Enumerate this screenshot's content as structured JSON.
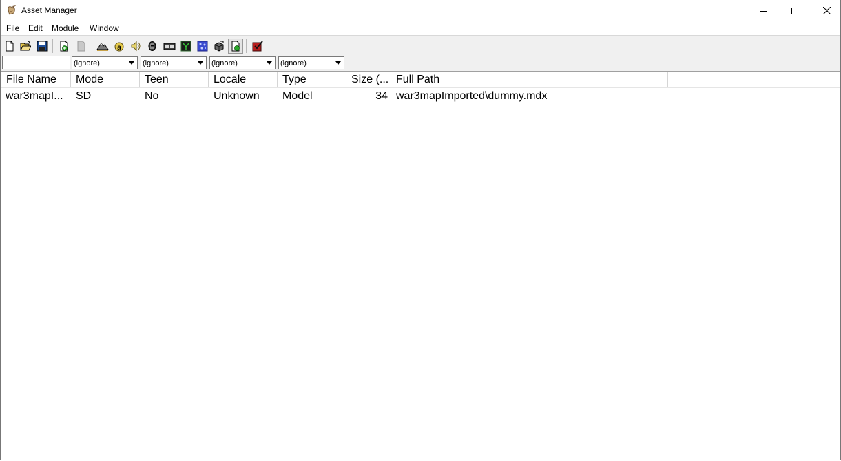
{
  "window": {
    "title": "Asset Manager",
    "icon": "scroll-quill-icon",
    "controls": [
      "minimize-icon",
      "maximize-icon",
      "close-icon"
    ]
  },
  "menu": {
    "items": [
      {
        "label": "File"
      },
      {
        "label": "Edit"
      },
      {
        "label": "Module"
      },
      {
        "label": "Window"
      }
    ]
  },
  "toolbar": {
    "buttons": [
      {
        "icon": "new-document-icon"
      },
      {
        "icon": "open-folder-icon"
      },
      {
        "icon": "save-disk-icon"
      },
      {
        "icon": "import-file-icon"
      },
      {
        "icon": "export-file-icon",
        "disabled": true
      },
      {
        "icon": "terrain-editor-icon"
      },
      {
        "icon": "trigger-editor-icon"
      },
      {
        "icon": "sound-editor-icon"
      },
      {
        "icon": "object-editor-icon"
      },
      {
        "icon": "campaign-editor-icon"
      },
      {
        "icon": "ai-editor-icon"
      },
      {
        "icon": "object-manager-icon"
      },
      {
        "icon": "import-manager-icon"
      },
      {
        "icon": "asset-manager-icon",
        "pressed": true
      },
      {
        "icon": "test-map-icon"
      }
    ]
  },
  "filters": {
    "search_value": "",
    "combos": [
      {
        "value": "(ignore)"
      },
      {
        "value": "(ignore)"
      },
      {
        "value": "(ignore)"
      },
      {
        "value": "(ignore)"
      }
    ]
  },
  "table": {
    "columns": [
      "File Name",
      "Mode",
      "Teen",
      "Locale",
      "Type",
      "Size (...",
      "Full Path"
    ],
    "rows": [
      [
        "war3mapI...",
        "SD",
        "No",
        "Unknown",
        "Model",
        "34",
        "war3mapImported\\dummy.mdx"
      ]
    ]
  }
}
